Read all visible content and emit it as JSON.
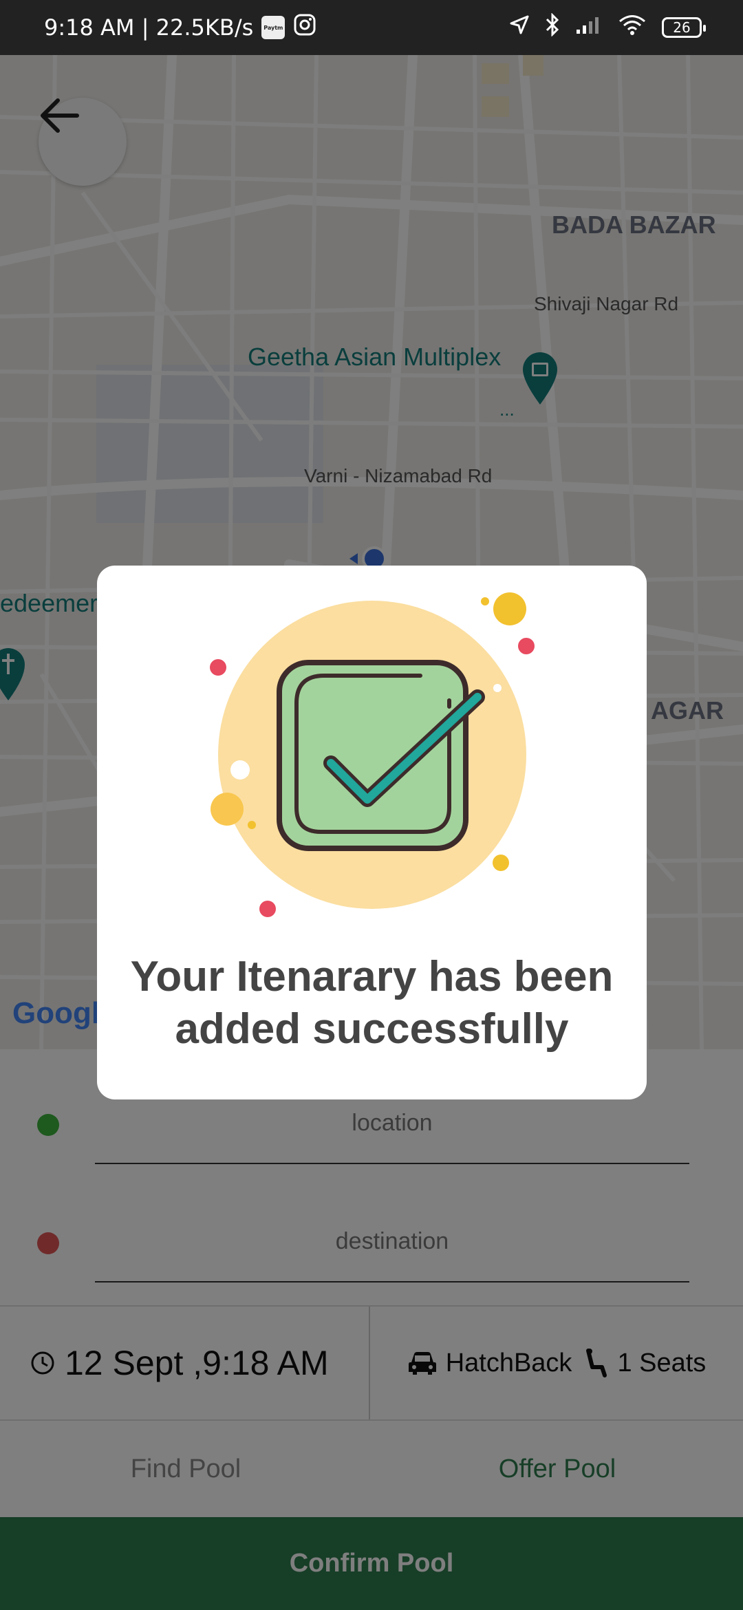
{
  "status_bar": {
    "time_speed": "9:18 AM | 22.5KB/s",
    "app_badge": "Paytm",
    "battery": "26"
  },
  "map": {
    "labels": {
      "bada_bazar": "BADA BAZAR",
      "shivaji": "Shivaji Nagar Rd",
      "geetha": "Geetha Asian Multiplex",
      "varni": "Varni - Nizamabad Rd",
      "redeemer": "edeemer",
      "nagar": "AGAR",
      "google": "Googl",
      "more": "..."
    }
  },
  "form": {
    "location_placeholder": "location",
    "destination_placeholder": "destination",
    "datetime": "12 Sept ,9:18 AM",
    "car_type": "HatchBack",
    "seats": "1 Seats"
  },
  "tabs": {
    "find": "Find Pool",
    "offer": "Offer Pool"
  },
  "confirm_label": "Confirm Pool",
  "modal": {
    "message": "Your Itenarary has been added successfully"
  },
  "colors": {
    "accent_green": "#2e7d4f",
    "location_dot": "#3cb33c",
    "destination_dot": "#e05555"
  }
}
